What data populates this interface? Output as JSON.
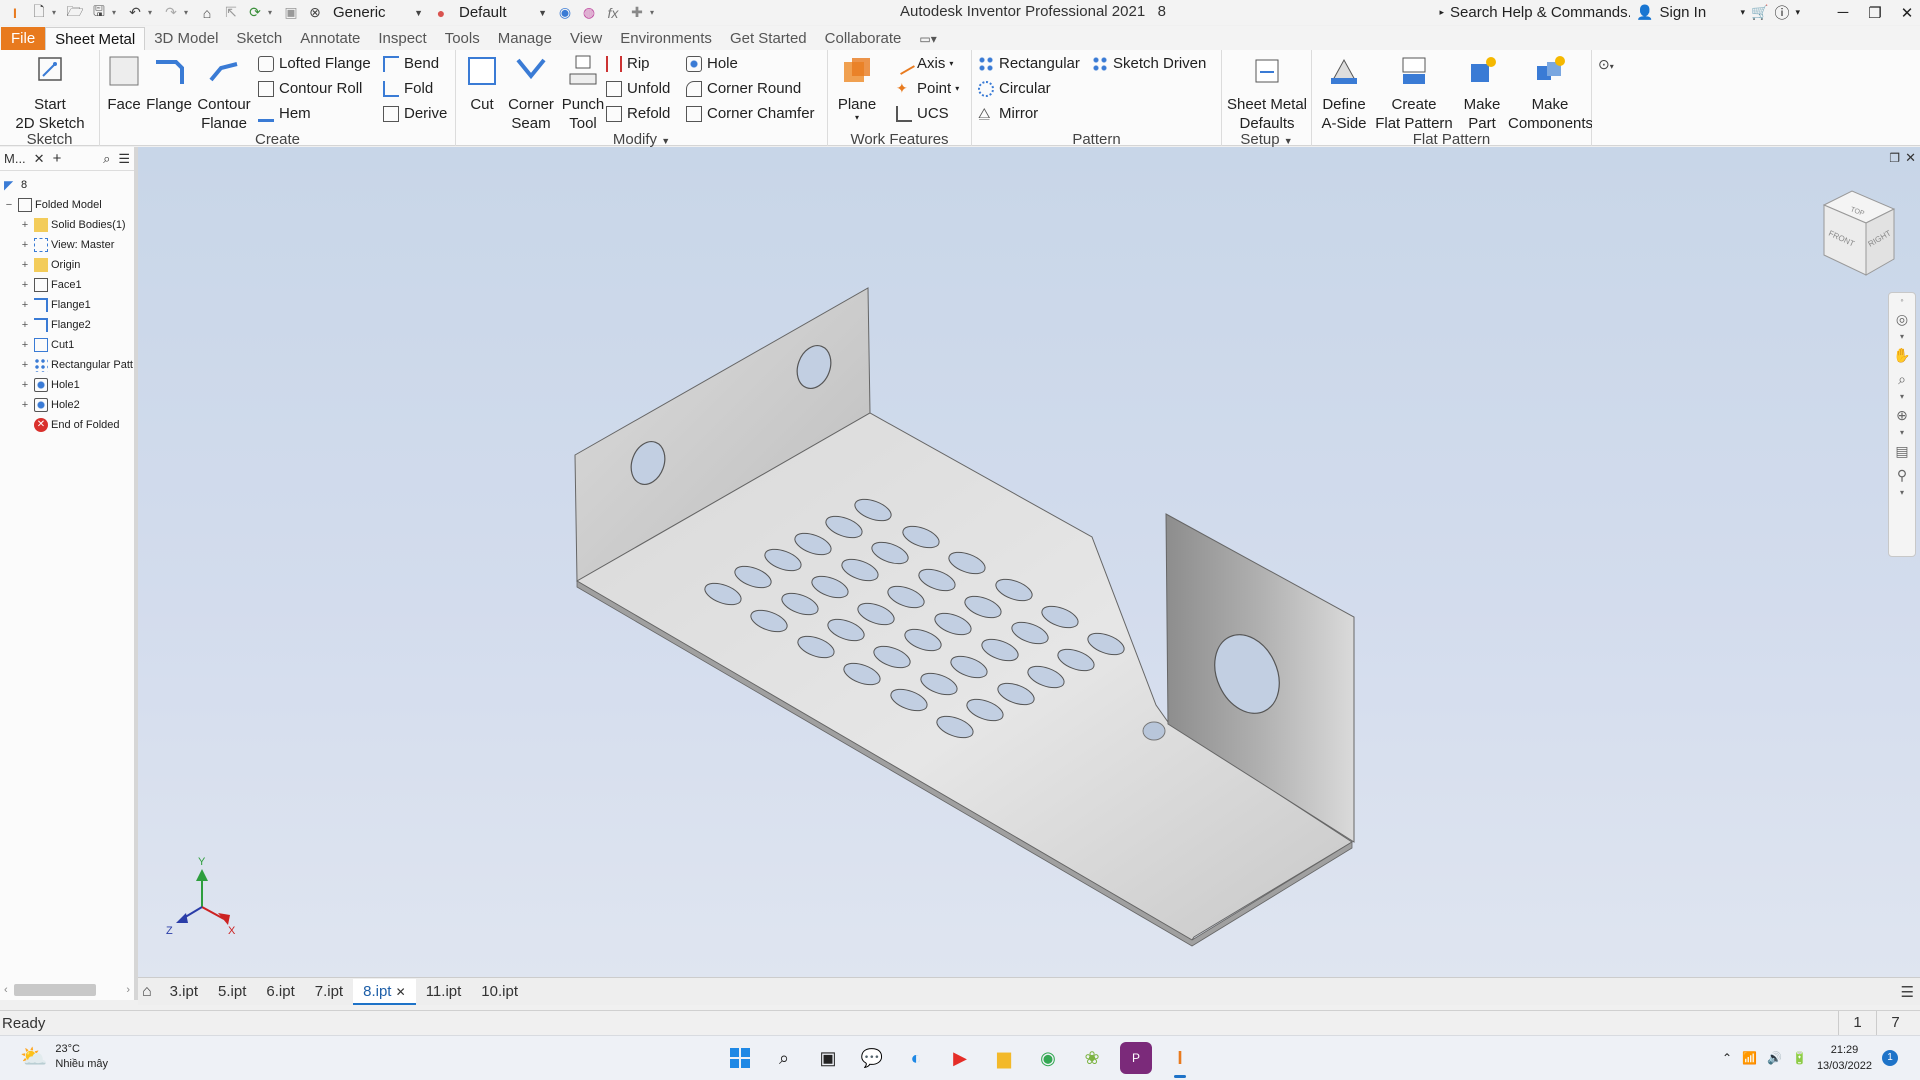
{
  "titlebar": {
    "style_combo": "Generic",
    "appearance_combo": "Default",
    "app_title": "Autodesk Inventor Professional 2021",
    "doc_number": "8",
    "search_placeholder": "Search Help & Commands...",
    "sign_in": "Sign In"
  },
  "ribbon_tabs": [
    "File",
    "Sheet Metal",
    "3D Model",
    "Sketch",
    "Annotate",
    "Inspect",
    "Tools",
    "Manage",
    "View",
    "Environments",
    "Get Started",
    "Collaborate"
  ],
  "ribbon": {
    "sketch": {
      "label": "Sketch",
      "start_line1": "Start",
      "start_line2": "2D Sketch"
    },
    "create": {
      "label": "Create",
      "face": "Face",
      "flange": "Flange",
      "contour_line1": "Contour",
      "contour_line2": "Flange",
      "lofted_flange": "Lofted Flange",
      "contour_roll": "Contour Roll",
      "hem": "Hem",
      "bend": "Bend",
      "fold": "Fold",
      "derive": "Derive"
    },
    "modify": {
      "label": "Modify",
      "cut": "Cut",
      "corner_seam_line1": "Corner",
      "corner_seam_line2": "Seam",
      "punch_tool_line1": "Punch",
      "punch_tool_line2": "Tool",
      "rip": "Rip",
      "unfold": "Unfold",
      "refold": "Refold",
      "hole": "Hole",
      "corner_round": "Corner Round",
      "corner_chamfer": "Corner Chamfer"
    },
    "work_features": {
      "label": "Work Features",
      "plane": "Plane",
      "axis": "Axis",
      "point": "Point",
      "ucs": "UCS"
    },
    "pattern": {
      "label": "Pattern",
      "rectangular": "Rectangular",
      "circular": "Circular",
      "mirror": "Mirror",
      "sketch_driven": "Sketch Driven"
    },
    "setup": {
      "label": "Setup",
      "defaults_line1": "Sheet Metal",
      "defaults_line2": "Defaults"
    },
    "flat_pattern": {
      "label": "Flat Pattern",
      "define_line1": "Define",
      "define_line2": "A-Side",
      "create_line1": "Create",
      "create_line2": "Flat Pattern",
      "make_part_line1": "Make",
      "make_part_line2": "Part",
      "make_comp_line1": "Make",
      "make_comp_line2": "Components"
    }
  },
  "browser": {
    "title": "M...",
    "part_name": "8",
    "root": "Folded Model",
    "nodes": [
      "Solid Bodies(1)",
      "View: Master",
      "Origin",
      "Face1",
      "Flange1",
      "Flange2",
      "Cut1",
      "Rectangular Patt",
      "Hole1",
      "Hole2"
    ],
    "end_node": "End of Folded"
  },
  "doc_tabs": [
    "3.ipt",
    "5.ipt",
    "6.ipt",
    "7.ipt",
    "8.ipt",
    "11.ipt",
    "10.ipt"
  ],
  "active_doc_tab": "8.ipt",
  "viewcube": {
    "top": "TOP",
    "front": "FRONT",
    "right": "RIGHT"
  },
  "triad": {
    "x": "X",
    "y": "Y",
    "z": "Z"
  },
  "status": {
    "text": "Ready",
    "num1": "1",
    "num2": "7"
  },
  "taskbar": {
    "temp": "23°C",
    "weather": "Nhiều mây",
    "time": "21:29",
    "date": "13/03/2022",
    "notifications": "1"
  },
  "colors": {
    "file_tab": "#e87a1e",
    "accent": "#1e73c8",
    "viewport_top": "#c8d6e8",
    "viewport_bottom": "#dfe5f0"
  }
}
